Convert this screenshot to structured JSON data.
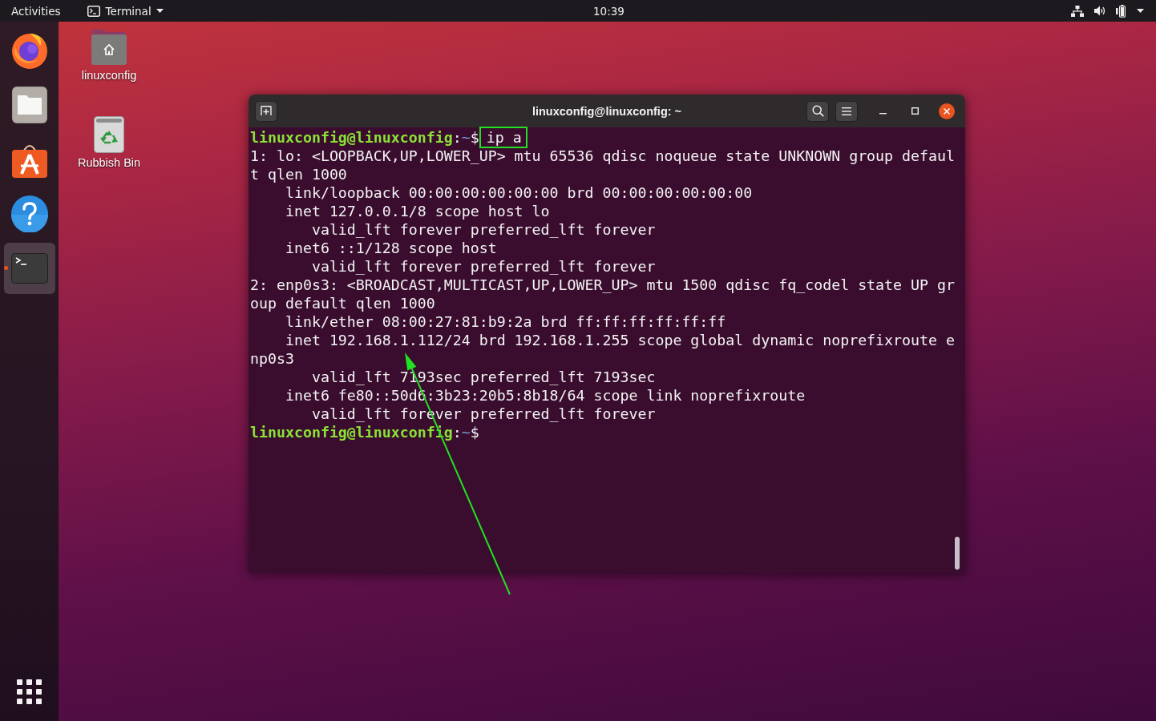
{
  "top_bar": {
    "activities": "Activities",
    "app_menu": "Terminal",
    "clock": "10:39"
  },
  "dock": {
    "items": [
      {
        "kind": "browser",
        "running": false,
        "selected": false
      },
      {
        "kind": "files",
        "running": false,
        "selected": false
      },
      {
        "kind": "software",
        "running": false,
        "selected": false
      },
      {
        "kind": "help",
        "running": false,
        "selected": false
      },
      {
        "kind": "terminal",
        "running": true,
        "selected": true
      }
    ]
  },
  "desktop_icons": [
    {
      "kind": "home-folder",
      "label": "linuxconfig"
    },
    {
      "kind": "trash",
      "label": "Rubbish Bin"
    }
  ],
  "terminal": {
    "title": "linuxconfig@linuxconfig: ~",
    "lines": [
      {
        "kind": "prompt",
        "user_host": "linuxconfig@linuxconfig",
        "separator": ":",
        "path": "~",
        "symbol": "$",
        "command": "ip a",
        "highlighted": true
      },
      {
        "kind": "output",
        "text": "1: lo: <LOOPBACK,UP,LOWER_UP> mtu 65536 qdisc noqueue state UNKNOWN group defaul"
      },
      {
        "kind": "output",
        "text": "t qlen 1000"
      },
      {
        "kind": "output",
        "text": "    link/loopback 00:00:00:00:00:00 brd 00:00:00:00:00:00"
      },
      {
        "kind": "output",
        "text": "    inet 127.0.0.1/8 scope host lo"
      },
      {
        "kind": "output",
        "text": "       valid_lft forever preferred_lft forever"
      },
      {
        "kind": "output",
        "text": "    inet6 ::1/128 scope host"
      },
      {
        "kind": "output",
        "text": "       valid_lft forever preferred_lft forever"
      },
      {
        "kind": "output",
        "text": "2: enp0s3: <BROADCAST,MULTICAST,UP,LOWER_UP> mtu 1500 qdisc fq_codel state UP gr"
      },
      {
        "kind": "output",
        "text": "oup default qlen 1000"
      },
      {
        "kind": "output",
        "text": "    link/ether 08:00:27:81:b9:2a brd ff:ff:ff:ff:ff:ff"
      },
      {
        "kind": "output",
        "text": "    inet 192.168.1.112/24 brd 192.168.1.255 scope global dynamic noprefixroute e"
      },
      {
        "kind": "output",
        "text": "np0s3"
      },
      {
        "kind": "output",
        "text": "       valid_lft 7193sec preferred_lft 7193sec"
      },
      {
        "kind": "output",
        "text": "    inet6 fe80::50d6:3b23:20b5:8b18/64 scope link noprefixroute"
      },
      {
        "kind": "output",
        "text": "       valid_lft forever preferred_lft forever"
      },
      {
        "kind": "prompt",
        "user_host": "linuxconfig@linuxconfig",
        "separator": ":",
        "path": "~",
        "symbol": "$",
        "highlighted": false
      }
    ]
  },
  "annotation_arrow": true
}
